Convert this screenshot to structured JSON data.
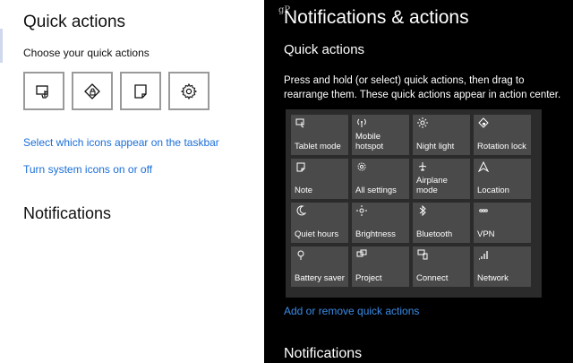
{
  "left": {
    "title": "Quick actions",
    "subtitle": "Choose your quick actions",
    "quick_tiles": [
      {
        "icon": "tablet-mode-icon"
      },
      {
        "icon": "rotation-lock-icon"
      },
      {
        "icon": "note-icon"
      },
      {
        "icon": "all-settings-icon"
      }
    ],
    "link_taskbar_icons": "Select which icons appear on the taskbar",
    "link_system_icons": "Turn system icons on or off",
    "notifications_heading": "Notifications"
  },
  "right": {
    "watermark": "gP",
    "title": "Notifications & actions",
    "section_title": "Quick actions",
    "description": "Press and hold (or select) quick actions, then drag to rearrange them. These quick actions appear in action center.",
    "tiles": [
      {
        "label": "Tablet mode",
        "icon": "tablet-mode-icon"
      },
      {
        "label": "Mobile hotspot",
        "icon": "hotspot-icon"
      },
      {
        "label": "Night light",
        "icon": "sun-icon"
      },
      {
        "label": "Rotation lock",
        "icon": "rotation-lock-icon"
      },
      {
        "label": "Note",
        "icon": "note-icon"
      },
      {
        "label": "All settings",
        "icon": "gear-icon"
      },
      {
        "label": "Airplane mode",
        "icon": "airplane-icon"
      },
      {
        "label": "Location",
        "icon": "location-icon"
      },
      {
        "label": "Quiet hours",
        "icon": "moon-icon"
      },
      {
        "label": "Brightness",
        "icon": "brightness-icon"
      },
      {
        "label": "Bluetooth",
        "icon": "bluetooth-icon"
      },
      {
        "label": "VPN",
        "icon": "vpn-icon"
      },
      {
        "label": "Battery saver",
        "icon": "battery-saver-icon"
      },
      {
        "label": "Project",
        "icon": "project-icon"
      },
      {
        "label": "Connect",
        "icon": "connect-icon"
      },
      {
        "label": "Network",
        "icon": "network-icon"
      }
    ],
    "add_remove_link": "Add or remove quick actions",
    "notifications_heading": "Notifications"
  },
  "colors": {
    "accent_link_light": "#1a6ed8",
    "accent_link_dark": "#3b8ce8",
    "tile_bg": "#4a4a4a",
    "grid_bg": "#2b2b2b"
  }
}
